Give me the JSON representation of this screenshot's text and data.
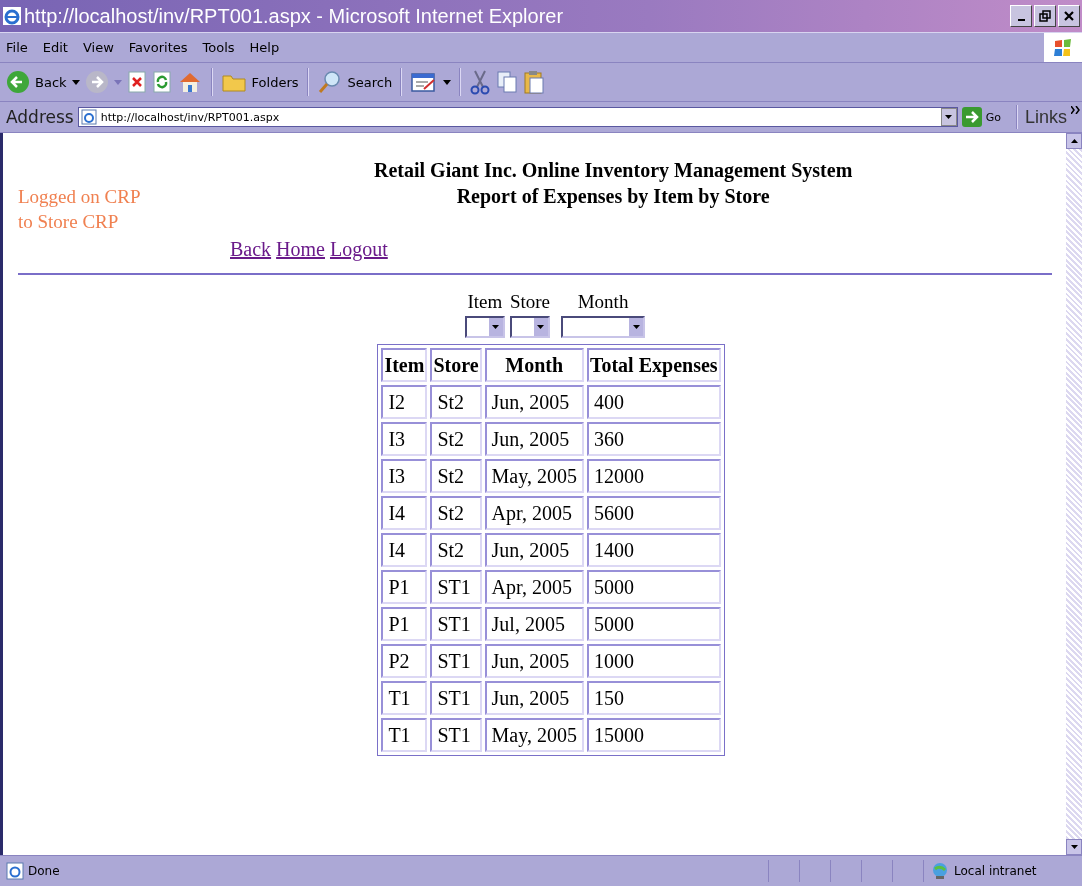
{
  "window": {
    "title": "http://localhost/inv/RPT001.aspx - Microsoft Internet Explorer"
  },
  "menu": [
    "File",
    "Edit",
    "View",
    "Favorites",
    "Tools",
    "Help"
  ],
  "toolbar": {
    "back_label": "Back",
    "folders_label": "Folders",
    "search_label": "Search"
  },
  "address": {
    "label": "Address",
    "url": "http://localhost/inv/RPT001.aspx",
    "go_label": "Go",
    "links_label": "Links"
  },
  "page": {
    "login_lines": [
      "Logged on CRP",
      "to Store CRP"
    ],
    "title": "Retail Giant Inc. Online Inventory Management System",
    "subtitle": "Report of Expenses by Item by Store",
    "nav_links": [
      "Back",
      "Home",
      "Logout"
    ],
    "filters": [
      {
        "label": "Item"
      },
      {
        "label": "Store"
      },
      {
        "label": "Month"
      }
    ],
    "table": {
      "columns": [
        "Item",
        "Store",
        "Month",
        "Total Expenses"
      ],
      "rows": [
        [
          "I2",
          "St2",
          "Jun, 2005",
          "400"
        ],
        [
          "I3",
          "St2",
          "Jun, 2005",
          "360"
        ],
        [
          "I3",
          "St2",
          "May, 2005",
          "12000"
        ],
        [
          "I4",
          "St2",
          "Apr, 2005",
          "5600"
        ],
        [
          "I4",
          "St2",
          "Jun, 2005",
          "1400"
        ],
        [
          "P1",
          "ST1",
          "Apr, 2005",
          "5000"
        ],
        [
          "P1",
          "ST1",
          "Jul, 2005",
          "5000"
        ],
        [
          "P2",
          "ST1",
          "Jun, 2005",
          "1000"
        ],
        [
          "T1",
          "ST1",
          "Jun, 2005",
          "150"
        ],
        [
          "T1",
          "ST1",
          "May, 2005",
          "15000"
        ]
      ]
    }
  },
  "status_bar": {
    "text": "Done",
    "zone": "Local intranet"
  }
}
